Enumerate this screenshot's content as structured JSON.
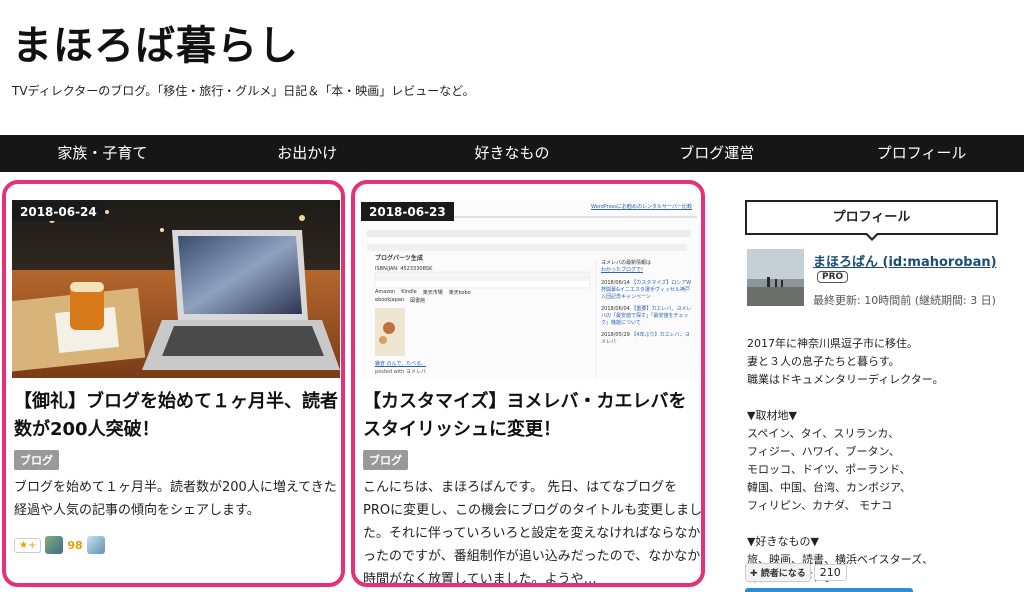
{
  "header": {
    "site_title": "まほろば暮らし",
    "site_description": "TVディレクターのブログ。「移住・旅行・グルメ」日記＆「本・映画」レビューなど。"
  },
  "nav": {
    "items": [
      {
        "label": "家族・子育て"
      },
      {
        "label": "お出かけ"
      },
      {
        "label": "好きなもの"
      },
      {
        "label": "ブログ運営"
      },
      {
        "label": "プロフィール"
      }
    ]
  },
  "cards": [
    {
      "date": "2018-06-24",
      "title": "【御礼】ブログを始めて１ヶ月半、読者数が200人突破！",
      "category": "ブログ",
      "excerpt": "ブログを始めて１ヶ月半。読者数が200人に増えてきた経過や人気の記事の傾向をシェアします。",
      "star_label": "★+",
      "star_count": "98"
    },
    {
      "date": "2018-06-23",
      "title": "【カスタマイズ】ヨメレバ・カエレバをスタイリッシュに変更！",
      "category": "ブログ",
      "excerpt": "こんにちは、まほろばんです。 先日、はてなブログをPROに変更し、この機会にブログのタイトルも変更しました。それに伴っていろいろと設定を変えなければならなかったのですが、番組制作が追い込みだったので、なかなか時間がなく放置していました。ようや…",
      "screenshot": {
        "banner": "WordPressにお勧めのレンタルサーバー比較",
        "section_title": "ブログパーツ生成",
        "isbn": "ISBN/JAN: 4523330BSK",
        "check_amazon": "Amazon",
        "check_kindle": "Kindle",
        "check_rakuten": "楽天市場",
        "check_kobo": "楽天kobo",
        "ebookjapan": "ebookjapan",
        "shelf": "図書館",
        "book_title": "鎌倉 のんで、たべる。",
        "posted_with": "posted with ヨメレバ",
        "side_head": "ヨメレバの最新情報は",
        "side_link": "わかったブログで!",
        "side_entries": [
          {
            "date": "2018/06/14",
            "text": "【カスタマイズ】ロシアW杯開幕&イニエスタ選手ヴィッセル神戸入団記念キャンペーン"
          },
          {
            "date": "2018/06/04",
            "text": "【重要】カエレバ、ヨメレバの「最安値で探す」「最安値をチェック」機能について"
          },
          {
            "date": "2018/05/29",
            "text": "【4年ぶり】カエレバ、ヨメレバ"
          }
        ]
      }
    }
  ],
  "sidebar": {
    "heading": "プロフィール",
    "name": "まほろばん (id:mahoroban)",
    "pro_badge": "PRO",
    "last_updated": "最終更新: 10時間前 (継続期間: 3 日)",
    "bio_lines": [
      "2017年に神奈川県逗子市に移住。",
      "妻と３人の息子たちと暮らす。",
      "職業はドキュメンタリーディレクター。"
    ],
    "areas_heading": "▼取材地▼",
    "areas_lines": [
      "スペイン、タイ、スリランカ、",
      "フィジー、ハワイ、ブータン、",
      "モロッコ、ドイツ、ポーランド、",
      "韓国、中国、台湾、カンボジア、",
      "フィリピン、カナダ、 モナコ"
    ],
    "likes_heading": "▼好きなもの▼",
    "likes_lines": [
      "旅、映画、読書、横浜ベイスターズ、",
      "将棋、ジョギング"
    ],
    "reader_button": "読者になる",
    "reader_count": "210"
  },
  "colors": {
    "card_border": "#e6307a",
    "nav_bg": "#161616",
    "link": "#1a4d7a",
    "star": "#e8a000"
  }
}
